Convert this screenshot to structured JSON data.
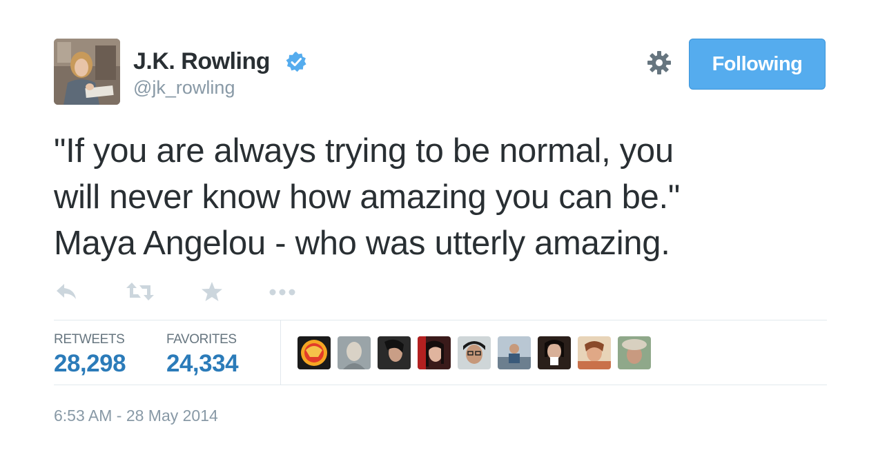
{
  "user": {
    "name": "J.K. Rowling",
    "screen_name": "@jk_rowling",
    "verified": true
  },
  "follow_button": {
    "label": "Following"
  },
  "tweet": {
    "text_lines": [
      "\"If you are always trying to be normal, you",
      "will never know how amazing you can be.\"",
      "Maya Angelou - who was utterly amazing."
    ]
  },
  "stats": {
    "retweets_label": "RETWEETS",
    "retweets_value": "28,298",
    "favorites_label": "FAVORITES",
    "favorites_value": "24,334"
  },
  "timestamp": "6:53 AM - 28 May 2014",
  "icons": {
    "reply": "reply-icon",
    "retweet": "retweet-icon",
    "favorite": "star-icon",
    "more": "more-icon",
    "settings": "gear-icon",
    "verified": "verified-badge-icon"
  },
  "colors": {
    "accent": "#55acee",
    "stat_value": "#2b7bb9",
    "muted": "#8899a6",
    "action_icon": "#ccd6dd",
    "text": "#292f33"
  }
}
